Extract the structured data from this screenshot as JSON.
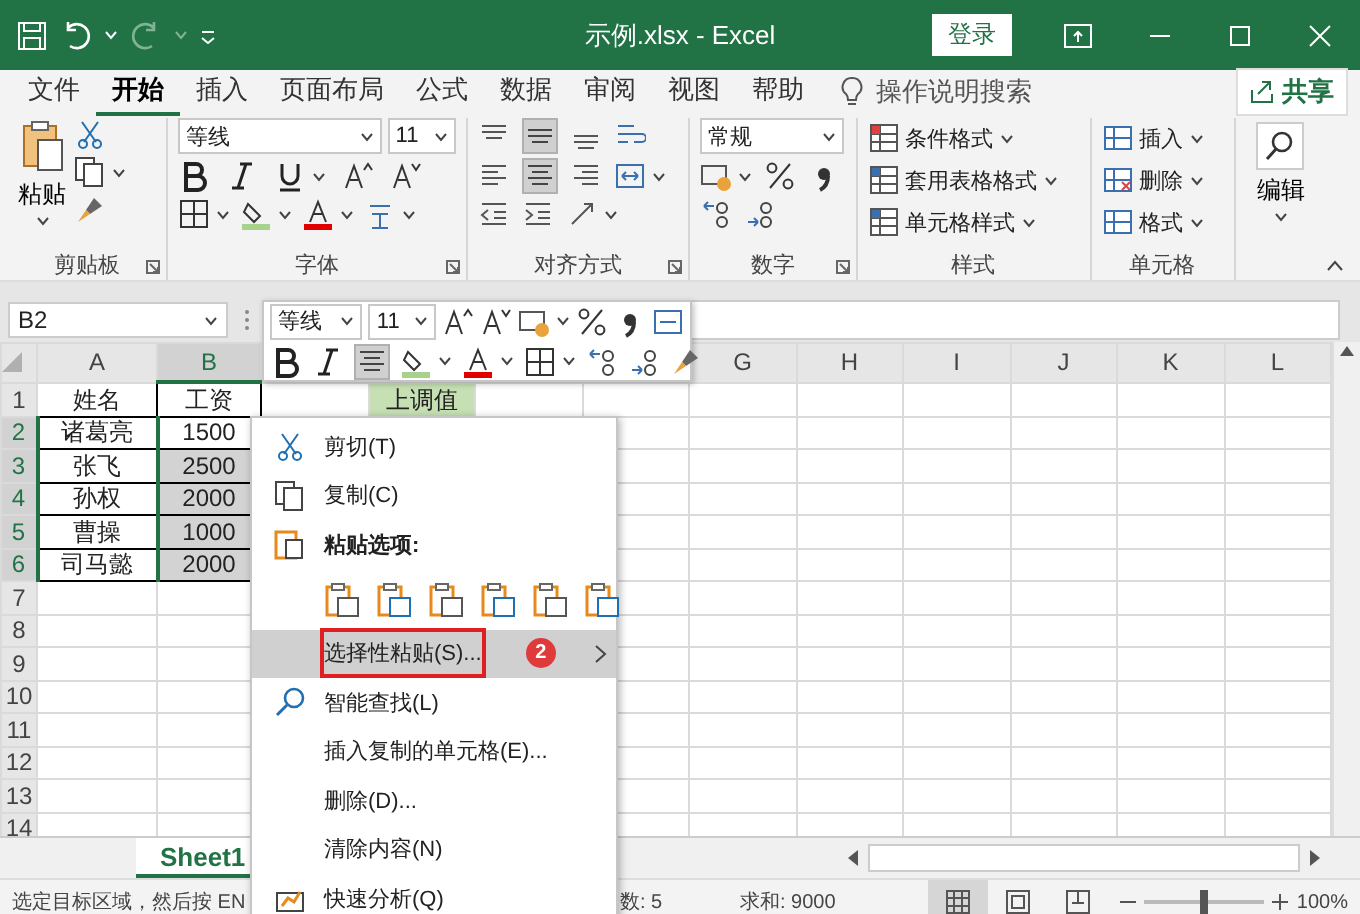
{
  "title_bar": {
    "title": "示例.xlsx  -  Excel",
    "login": "登录"
  },
  "menu_tabs": [
    {
      "label": "文件",
      "selected": false
    },
    {
      "label": "开始",
      "selected": true
    },
    {
      "label": "插入",
      "selected": false
    },
    {
      "label": "页面布局",
      "selected": false
    },
    {
      "label": "公式",
      "selected": false
    },
    {
      "label": "数据",
      "selected": false
    },
    {
      "label": "审阅",
      "selected": false
    },
    {
      "label": "视图",
      "selected": false
    },
    {
      "label": "帮助",
      "selected": false
    }
  ],
  "tell_me": "操作说明搜索",
  "share": "共享",
  "ribbon": {
    "clipboard": {
      "paste": "粘贴",
      "label": "剪贴板"
    },
    "font": {
      "name": "等线",
      "size": "11",
      "label": "字体"
    },
    "alignment": {
      "label": "对齐方式"
    },
    "number": {
      "format": "常规",
      "label": "数字"
    },
    "styles": {
      "items": [
        "条件格式",
        "套用表格格式",
        "单元格样式"
      ],
      "label": "样式"
    },
    "cells": {
      "items": [
        "插入",
        "删除",
        "格式"
      ],
      "label": "单元格"
    },
    "editing": {
      "label": "编辑"
    }
  },
  "formula_bar": {
    "name_box": "B2"
  },
  "sheet": {
    "columns": [
      {
        "label": "A",
        "selected": false
      },
      {
        "label": "B",
        "selected": true
      },
      {
        "label": "G",
        "selected": false
      },
      {
        "label": "H",
        "selected": false
      },
      {
        "label": "I",
        "selected": false
      },
      {
        "label": "J",
        "selected": false
      },
      {
        "label": "K",
        "selected": false
      },
      {
        "label": "L",
        "selected": false
      }
    ],
    "copied_cell": {
      "text": "上调值"
    },
    "rows": [
      {
        "number": "1",
        "selected": false,
        "cells": [
          {
            "text": "姓名",
            "selected": false
          },
          {
            "text": "工资",
            "selected": false
          }
        ]
      },
      {
        "number": "2",
        "selected": true,
        "cells": [
          {
            "text": "诸葛亮",
            "selected": false
          },
          {
            "text": "1500",
            "selected": false
          }
        ]
      },
      {
        "number": "3",
        "selected": true,
        "cells": [
          {
            "text": "张飞",
            "selected": false
          },
          {
            "text": "2500",
            "selected": true
          }
        ]
      },
      {
        "number": "4",
        "selected": true,
        "cells": [
          {
            "text": "孙权",
            "selected": false
          },
          {
            "text": "2000",
            "selected": true
          }
        ]
      },
      {
        "number": "5",
        "selected": true,
        "cells": [
          {
            "text": "曹操",
            "selected": false
          },
          {
            "text": "1000",
            "selected": true
          }
        ]
      },
      {
        "number": "6",
        "selected": true,
        "cells": [
          {
            "text": "司马懿",
            "selected": false
          },
          {
            "text": "2000",
            "selected": true
          }
        ]
      },
      {
        "number": "7",
        "selected": false
      },
      {
        "number": "8",
        "selected": false
      },
      {
        "number": "9",
        "selected": false
      },
      {
        "number": "10",
        "selected": false
      },
      {
        "number": "11",
        "selected": false
      },
      {
        "number": "12",
        "selected": false
      },
      {
        "number": "13",
        "selected": false
      },
      {
        "number": "14",
        "selected": false
      }
    ]
  },
  "mini_toolbar": {
    "font": "等线",
    "size": "11"
  },
  "context_menu": {
    "items": [
      {
        "kind": "command",
        "label": "剪切(T)",
        "highlighted": false,
        "submenu": false
      },
      {
        "kind": "command",
        "label": "复制(C)",
        "highlighted": false,
        "submenu": false
      },
      {
        "kind": "header",
        "label": "粘贴选项:"
      },
      {
        "kind": "paste_options"
      },
      {
        "kind": "command",
        "label": "选择性粘贴(S)...",
        "highlighted": true,
        "submenu": true,
        "badge": "2"
      },
      {
        "kind": "command",
        "label": "智能查找(L)",
        "highlighted": false,
        "submenu": false
      },
      {
        "kind": "command",
        "label": "插入复制的单元格(E)...",
        "highlighted": false,
        "submenu": false
      },
      {
        "kind": "command",
        "label": "删除(D)...",
        "highlighted": false,
        "submenu": false
      },
      {
        "kind": "command",
        "label": "清除内容(N)",
        "highlighted": false,
        "submenu": false
      },
      {
        "kind": "command",
        "label": "快速分析(Q)",
        "highlighted": false,
        "submenu": false
      }
    ]
  },
  "sheet_tabs": [
    {
      "label": "Sheet1",
      "selected": true
    }
  ],
  "status_bar": {
    "texts": [
      "选定目标区域，然后按 EN",
      "数: 5",
      "求和: 9000"
    ],
    "views": [
      {
        "selected": true
      },
      {
        "selected": false
      },
      {
        "selected": false
      }
    ],
    "zoom": {
      "level": 0.5,
      "reading": "100%"
    }
  }
}
